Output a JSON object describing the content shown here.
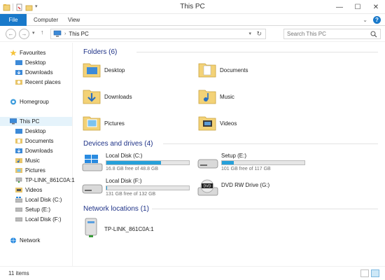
{
  "window": {
    "title": "This PC"
  },
  "ribbon": {
    "tabs": [
      {
        "label": "File"
      },
      {
        "label": "Computer"
      },
      {
        "label": "View"
      }
    ]
  },
  "address": {
    "breadcrumb": "This PC",
    "search_placeholder": "Search This PC"
  },
  "nav": {
    "favourites": "Favourites",
    "desktop": "Desktop",
    "downloads": "Downloads",
    "recent": "Recent places",
    "homegroup": "Homegroup",
    "this_pc": "This PC",
    "pc_desktop": "Desktop",
    "pc_documents": "Documents",
    "pc_downloads": "Downloads",
    "pc_music": "Music",
    "pc_pictures": "Pictures",
    "pc_tplink": "TP-LINK_861C0A:1",
    "pc_videos": "Videos",
    "pc_local_c": "Local Disk (C:)",
    "pc_setup_e": "Setup (E:)",
    "pc_local_f": "Local Disk (F:)",
    "network": "Network"
  },
  "content": {
    "folders_header": "Folders (6)",
    "folders": [
      {
        "label": "Desktop"
      },
      {
        "label": "Documents"
      },
      {
        "label": "Downloads"
      },
      {
        "label": "Music"
      },
      {
        "label": "Pictures"
      },
      {
        "label": "Videos"
      }
    ],
    "devices_header": "Devices and drives (4)",
    "drives": [
      {
        "name": "Local Disk (C:)",
        "free": "16.8 GB free of 48.8 GB",
        "used_fraction": 0.66
      },
      {
        "name": "Setup (E:)",
        "free": "101 GB free of 117 GB",
        "used_fraction": 0.14
      },
      {
        "name": "Local Disk (F:)",
        "free": "131 GB free of 132 GB",
        "used_fraction": 0.01
      },
      {
        "name": "DVD RW Drive (G:)"
      }
    ],
    "network_header": "Network locations (1)",
    "network_items": [
      {
        "label": "TP-LINK_861C0A:1"
      }
    ]
  },
  "status": {
    "items": "11 items"
  },
  "colors": {
    "accent": "#1979ca",
    "drive_bar": "#26a0da",
    "group_header": "#1e3287",
    "folder": "#f3d277"
  }
}
